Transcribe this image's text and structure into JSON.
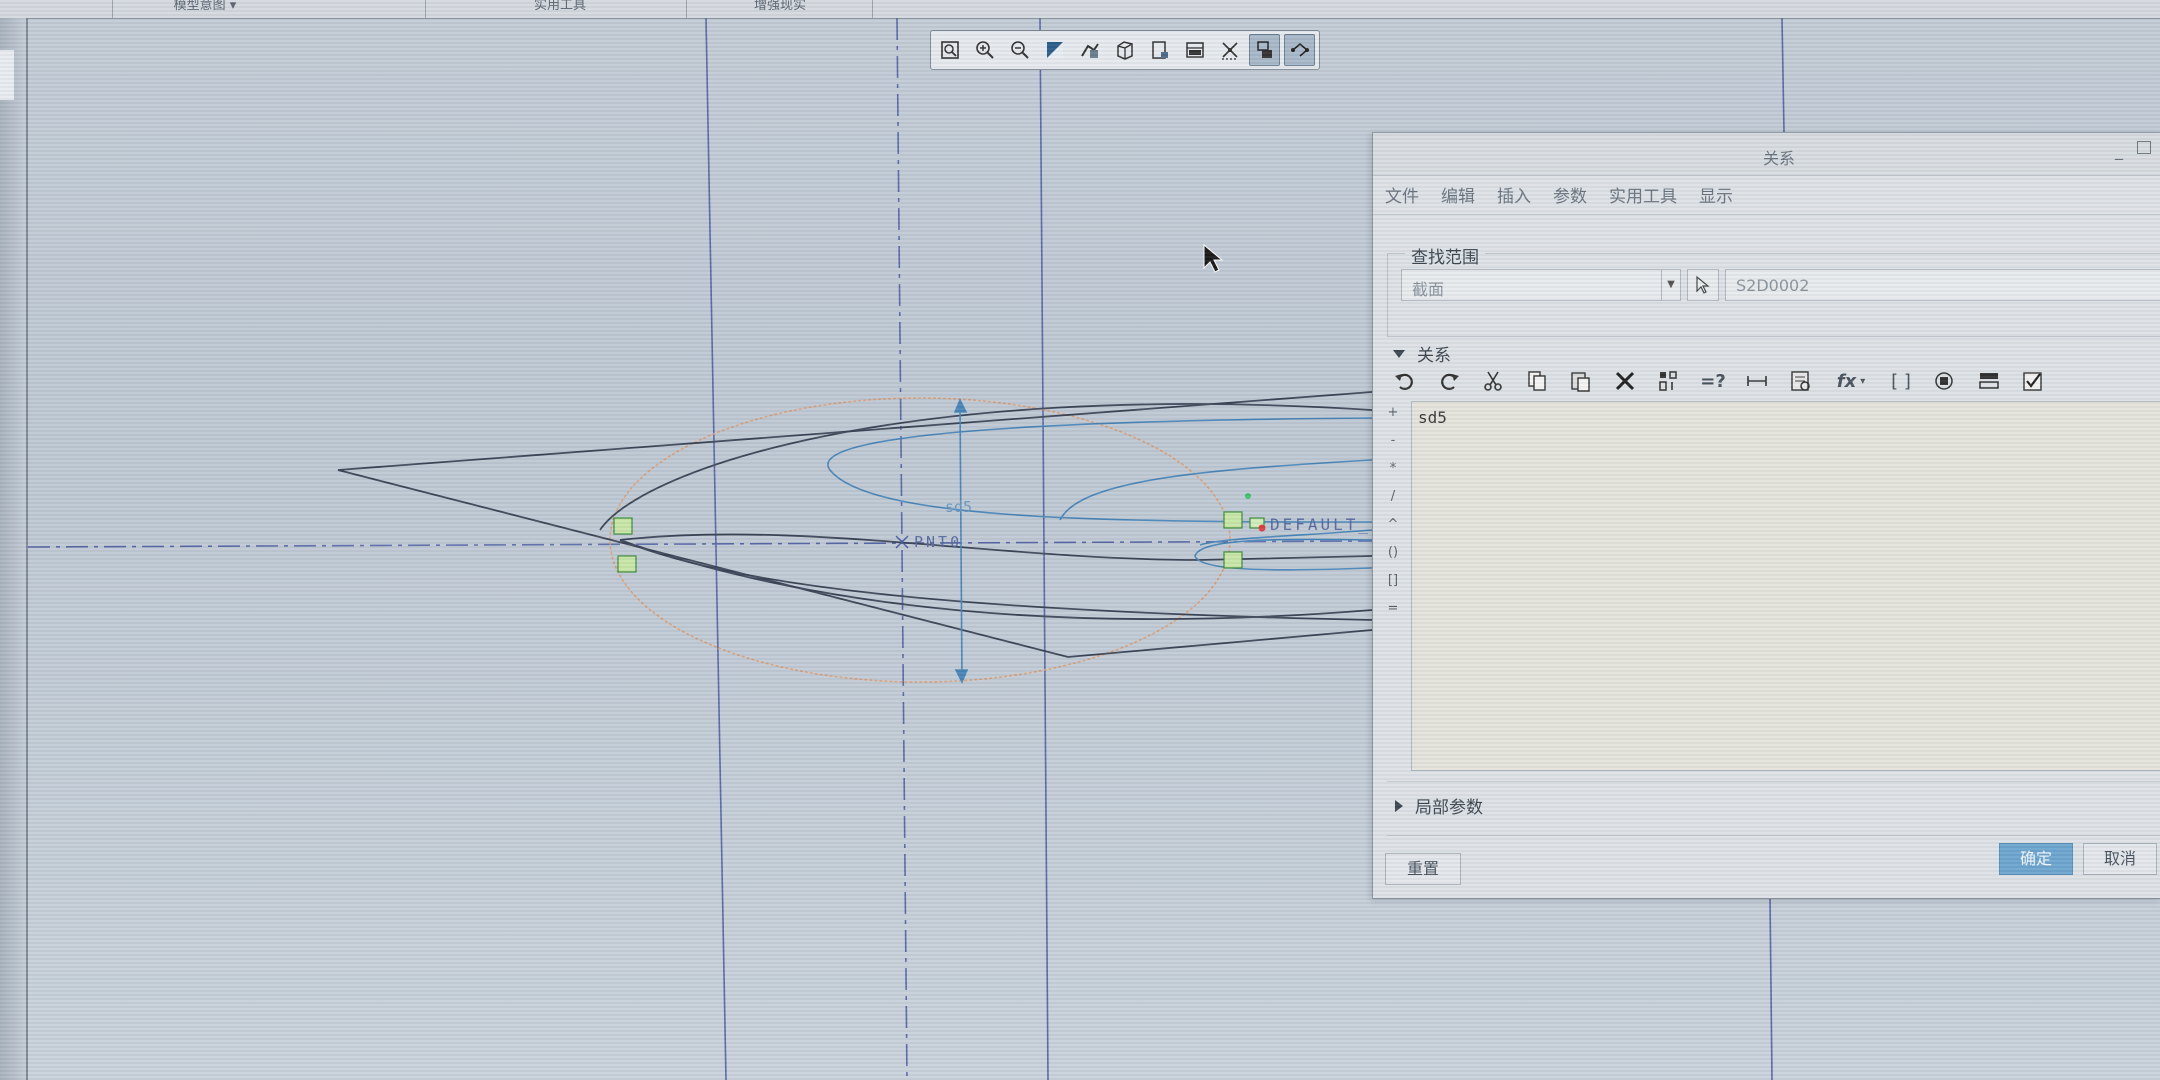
{
  "ribbon": {
    "tabs": [
      "模型意图",
      "实用工具",
      "增强现实"
    ]
  },
  "view_toolbar": {
    "buttons": [
      {
        "icon": "refit-icon",
        "active": false
      },
      {
        "icon": "zoom-in-icon",
        "active": false
      },
      {
        "icon": "zoom-out-icon",
        "active": false
      },
      {
        "icon": "repaint-icon",
        "active": false
      },
      {
        "icon": "display-style-icon",
        "active": false
      },
      {
        "icon": "saved-orientations-icon",
        "active": false
      },
      {
        "icon": "sketch-view-icon",
        "active": false
      },
      {
        "icon": "datum-display-icon",
        "active": false
      },
      {
        "icon": "dimension-display-icon",
        "active": false
      },
      {
        "icon": "constraint-display-icon",
        "active": true
      },
      {
        "icon": "vertex-display-icon",
        "active": true
      }
    ]
  },
  "sketch": {
    "dimension_label": "sd5",
    "point_label": "PNT0",
    "csys_label": "DEFAULT_C"
  },
  "dialog": {
    "title": "关系",
    "menu": [
      "文件",
      "编辑",
      "插入",
      "参数",
      "实用工具",
      "显示"
    ],
    "search_scope": {
      "legend": "查找范围",
      "type_value": "截面",
      "name_value": "S2D0002"
    },
    "relations_section": "关系",
    "operators": [
      "+",
      "-",
      "*",
      "/",
      "^",
      "()",
      "[]",
      "="
    ],
    "relations_text": "sd5",
    "local_params_section": "局部参数",
    "buttons": {
      "reset": "重置",
      "ok": "确定",
      "cancel": "取消"
    }
  }
}
